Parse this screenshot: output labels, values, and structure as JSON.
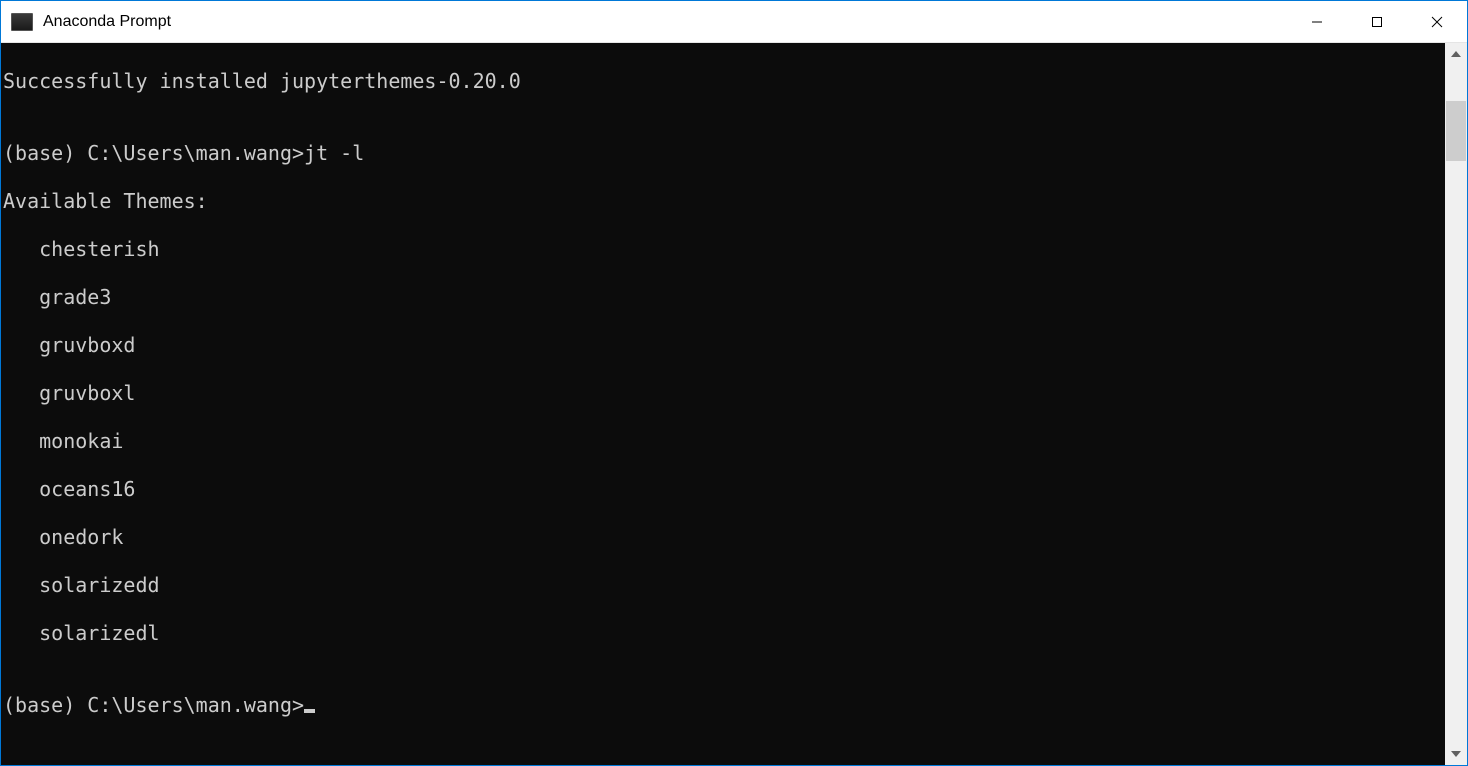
{
  "window": {
    "title": "Anaconda Prompt"
  },
  "terminal": {
    "line_install": "Successfully installed jupyterthemes-0.20.0",
    "blank1": "",
    "prompt1": "(base) C:\\Users\\man.wang>jt -l",
    "themes_header": "Available Themes:",
    "themes": [
      "chesterish",
      "grade3",
      "gruvboxd",
      "gruvboxl",
      "monokai",
      "oceans16",
      "onedork",
      "solarizedd",
      "solarizedl"
    ],
    "blank2": "",
    "prompt2": "(base) C:\\Users\\man.wang>"
  }
}
